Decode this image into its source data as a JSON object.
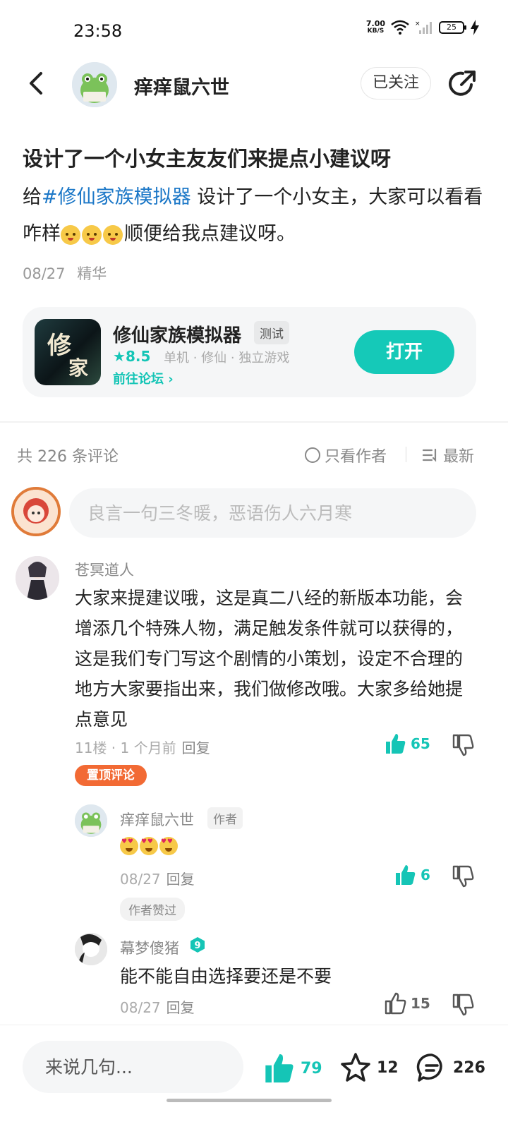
{
  "status": {
    "time": "23:58",
    "net_speed_value": "7.00",
    "net_speed_unit": "KB/S",
    "battery": "25"
  },
  "header": {
    "author_name": "痒痒鼠六世",
    "follow_label": "已关注"
  },
  "post": {
    "title": "设计了一个小女主友友们来提点小建议呀",
    "body_prefix": "给",
    "hashtag": "#修仙家族模拟器",
    "body_middle": " 设计了一个小女主，大家可以看看咋样",
    "body_suffix": "顺便给我点建议呀。",
    "date": "08/27",
    "tag": "精华"
  },
  "game_card": {
    "icon_glyph_1": "修",
    "icon_glyph_2": "家",
    "name": "修仙家族模拟器",
    "tag": "测试",
    "rating": "8.5",
    "genres": "单机 · 修仙 · 独立游戏",
    "forum_link": "前往论坛",
    "open_label": "打开"
  },
  "comments_header": {
    "count_label": "共 226 条评论",
    "only_author_label": "只看作者",
    "sort_label": "最新"
  },
  "comment_input": {
    "placeholder": "良言一句三冬暖，恶语伤人六月寒"
  },
  "comments": [
    {
      "user": "苍冥道人",
      "body": "大家来提建议哦，这是真二八经的新版本功能，会增添几个特殊人物，满足触发条件就可以获得的，这是我们专门写这个剧情的小策划，设定不合理的地方大家要指出来，我们做修改哦。大家多给她提点意见",
      "meta": "11楼 · 1 个月前",
      "reply_label": "回复",
      "likes": "65",
      "pin_label": "置顶评论"
    }
  ],
  "replies": [
    {
      "user": "痒痒鼠六世",
      "author_badge": "作者",
      "date": "08/27",
      "reply_label": "回复",
      "likes": "6",
      "liked_badge": "作者赞过"
    },
    {
      "user": "幕梦傻猪",
      "level": "9",
      "body": "能不能自由选择要还是不要",
      "date": "08/27",
      "reply_label": "回复",
      "likes": "15"
    }
  ],
  "bottom_bar": {
    "input_placeholder": "来说几句...",
    "likes": "79",
    "favorites": "12",
    "comments": "226"
  },
  "colors": {
    "accent": "#15c9b8",
    "hashtag": "#1b77c7",
    "pin": "#f26a34"
  }
}
